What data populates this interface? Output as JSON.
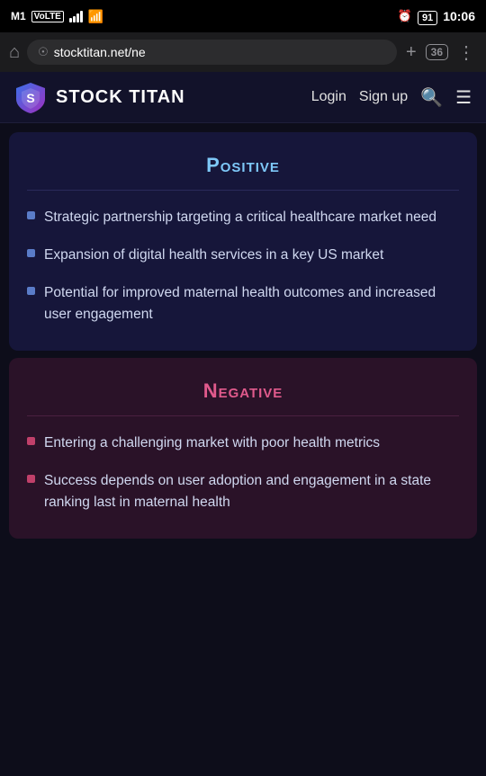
{
  "statusBar": {
    "carrier": "M1",
    "carrierTag": "VoLTE",
    "time": "10:06",
    "battery": "91",
    "alarm": true
  },
  "browser": {
    "url": "stocktitan.net/ne",
    "tabCount": "36",
    "homeLabel": "⌂",
    "addLabel": "+",
    "moreLabel": "⋮"
  },
  "siteNav": {
    "title": "STOCK TITAN",
    "loginLabel": "Login",
    "signupLabel": "Sign up"
  },
  "positiveCard": {
    "title": "Positive",
    "items": [
      "Strategic partnership targeting a critical healthcare market need",
      "Expansion of digital health services in a key US market",
      "Potential for improved maternal health outcomes and increased user engagement"
    ]
  },
  "negativeCard": {
    "title": "Negative",
    "items": [
      "Entering a challenging market with poor health metrics",
      "Success depends on user adoption and engagement in a state ranking last in maternal health"
    ]
  }
}
